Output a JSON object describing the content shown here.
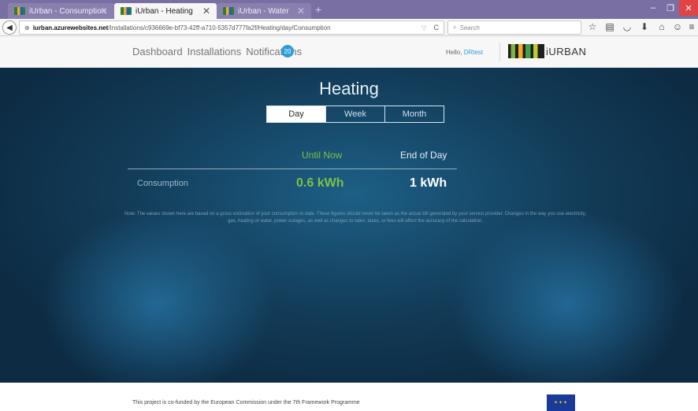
{
  "browser": {
    "tabs": [
      {
        "label": "iUrban - Consumption",
        "active": false
      },
      {
        "label": "iUrban - Heating",
        "active": true
      },
      {
        "label": "iUrban - Water",
        "active": false
      }
    ],
    "new_tab": "+",
    "url_host": "iurban.azurewebsites.net",
    "url_path": "/Installations/c936669e-bf73-42ff-a710-5357d777fa2f/Heating/day/Consumption",
    "search_placeholder": "Search",
    "window_controls": {
      "minimize": "–",
      "restore": "❐",
      "close": "✕"
    }
  },
  "appbar": {
    "nav": [
      "Dashboard",
      "Installations",
      "Notifications"
    ],
    "notification_count": "20",
    "hello_prefix": "Hello, ",
    "username": "DRtest",
    "logo_text": "iURBAN"
  },
  "main": {
    "title": "Heating",
    "periods": [
      "Day",
      "Week",
      "Month"
    ],
    "selected_period": "Day",
    "col_until": "Until Now",
    "col_end": "End of Day",
    "row_label": "Consumption",
    "value_until": "0.6 kWh",
    "value_end": "1 kWh",
    "note": "Note: The values shown here are based on a gross estimation of your consumption to date. These figures should never be taken as the actual bill generated by your service provider. Changes in the way you use electricity, gas, heating or water, power outages, as well as changes to rates, taxes, or fees will affect the accuracy of the calculation."
  },
  "footer": {
    "text": "This project is co-funded by the European Commission under the 7th Framework Programme"
  },
  "colors": {
    "accent": "#2e9cd6",
    "until_green": "#7cc244",
    "hero_dark": "#123b57"
  }
}
